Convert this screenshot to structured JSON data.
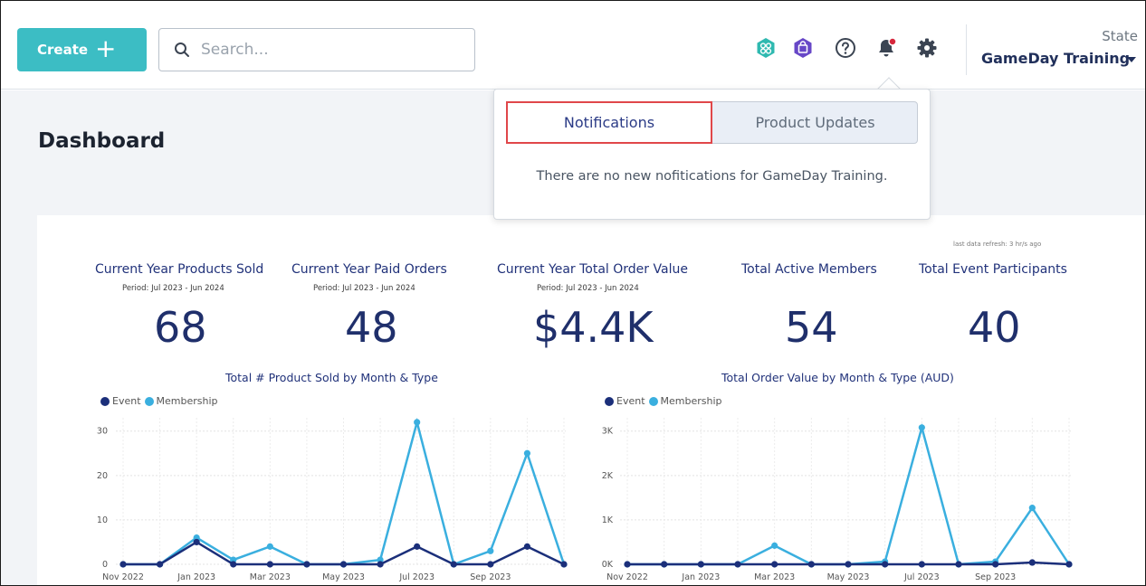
{
  "header": {
    "create_label": "Create",
    "search_placeholder": "Search...",
    "state_label": "State",
    "org_name": "GameDay Training",
    "icons": [
      "community-icon",
      "shop-icon",
      "help-icon",
      "bell-icon",
      "gear-icon"
    ],
    "accent_color": "#3cbdc4"
  },
  "page": {
    "title": "Dashboard"
  },
  "notifications": {
    "tabs": [
      "Notifications",
      "Product Updates"
    ],
    "active_tab": "Notifications",
    "empty_message": "There are no new nofitications for GameDay Training."
  },
  "report": {
    "refresh_note": "last data refresh: 3 hr/s ago",
    "kpis": [
      {
        "title": "Current Year Products Sold",
        "period": "Period: Jul 2023 - Jun 2024",
        "value": "68"
      },
      {
        "title": "Current Year Paid Orders",
        "period": "Period: Jul 2023 - Jun 2024",
        "value": "48"
      },
      {
        "title": "Current Year Total Order Value",
        "period": "Period: Jul 2023 - Jun 2024",
        "value": "$4.4K"
      },
      {
        "title": "Total Active Members",
        "period": "",
        "value": "54"
      },
      {
        "title": "Total Event Participants",
        "period": "",
        "value": "40"
      }
    ],
    "legend": {
      "event": "Event",
      "membership": "Membership"
    },
    "colors": {
      "event": "#1b2f7a",
      "membership": "#3aafdf"
    }
  },
  "chart_data": [
    {
      "type": "line",
      "title": "Total # Product Sold by Month & Type",
      "x": [
        "Nov 2022",
        "Dec 2022",
        "Jan 2023",
        "Feb 2023",
        "Mar 2023",
        "Apr 2023",
        "May 2023",
        "Jun 2023",
        "Jul 2023",
        "Aug 2023",
        "Sep 2023",
        "Oct 2023",
        "Nov 2023"
      ],
      "x_tick_labels": [
        "Nov 2022",
        "Jan 2023",
        "Mar 2023",
        "May 2023",
        "Jul 2023",
        "Sep 2023"
      ],
      "series": [
        {
          "name": "Event",
          "values": [
            0,
            0,
            5,
            0,
            0,
            0,
            0,
            0,
            4,
            0,
            0,
            4,
            0
          ]
        },
        {
          "name": "Membership",
          "values": [
            0,
            0,
            6,
            1,
            4,
            0,
            0,
            1,
            32,
            0,
            3,
            25,
            0
          ]
        }
      ],
      "ylim": [
        0,
        33
      ],
      "y_ticks": [
        "0",
        "10",
        "20",
        "30"
      ],
      "y_tick_values": [
        0,
        10,
        20,
        30
      ],
      "legend": "top-left",
      "grid": true
    },
    {
      "type": "line",
      "title": "Total Order Value by Month & Type (AUD)",
      "x": [
        "Nov 2022",
        "Dec 2022",
        "Jan 2023",
        "Feb 2023",
        "Mar 2023",
        "Apr 2023",
        "May 2023",
        "Jun 2023",
        "Jul 2023",
        "Aug 2023",
        "Sep 2023",
        "Oct 2023",
        "Nov 2023"
      ],
      "x_tick_labels": [
        "Nov 2022",
        "Jan 2023",
        "Mar 2023",
        "May 2023",
        "Jul 2023",
        "Sep 2023"
      ],
      "series": [
        {
          "name": "Event",
          "values": [
            0,
            0,
            0,
            0,
            0,
            0,
            0,
            0,
            0,
            0,
            0,
            40,
            0
          ]
        },
        {
          "name": "Membership",
          "values": [
            0,
            0,
            0,
            0,
            420,
            0,
            0,
            60,
            3080,
            0,
            60,
            1270,
            0
          ]
        }
      ],
      "ylim": [
        0,
        3300
      ],
      "y_ticks": [
        "0K",
        "1K",
        "2K",
        "3K"
      ],
      "y_tick_values": [
        0,
        1000,
        2000,
        3000
      ],
      "legend": "top-left",
      "grid": true
    }
  ]
}
